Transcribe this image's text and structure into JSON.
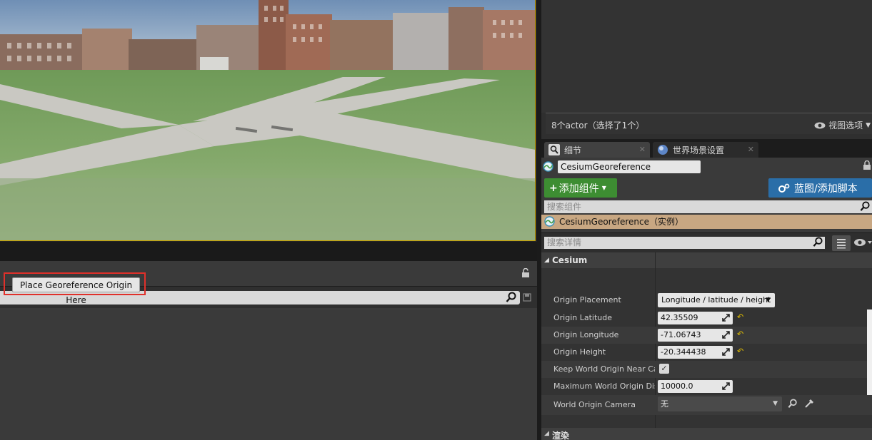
{
  "outliner": {
    "actor_count": "8个actor（选择了1个）",
    "view_options_label": "视图选项"
  },
  "details_tabs": [
    {
      "label": "细节"
    },
    {
      "label": "世界场景设置"
    }
  ],
  "details": {
    "actor_name": "CesiumGeoreference",
    "add_component_label": "添加组件",
    "blueprint_label": "蓝图/添加脚本",
    "component_search_placeholder": "搜索组件",
    "component_item": "CesiumGeoreference（实例）",
    "details_search_placeholder": "搜索详情"
  },
  "cesium": {
    "category_label": "Cesium",
    "place_origin_button": "Place Georeference Origin Here",
    "properties": {
      "origin_placement": {
        "label": "Origin Placement",
        "value": "Longitude / latitude / height"
      },
      "origin_latitude": {
        "label": "Origin Latitude",
        "value": "42.35509"
      },
      "origin_longitude": {
        "label": "Origin Longitude",
        "value": "-71.06743"
      },
      "origin_height": {
        "label": "Origin Height",
        "value": "-20.344438"
      },
      "keep_origin_near_camera": {
        "label": "Keep World Origin Near Cam",
        "checked": true
      },
      "max_origin_distance": {
        "label": "Maximum World Origin Dista",
        "value": "10000.0"
      },
      "world_origin_camera": {
        "label": "World Origin Camera",
        "value": "无"
      }
    }
  },
  "render_category": {
    "label": "渲染"
  },
  "colors": {
    "viewport_border": "#c9a200",
    "add_button": "#3d8d32",
    "blueprint_button": "#2a6ea8",
    "selected_component": "#c8a782",
    "highlight_frame": "#e0302a"
  }
}
